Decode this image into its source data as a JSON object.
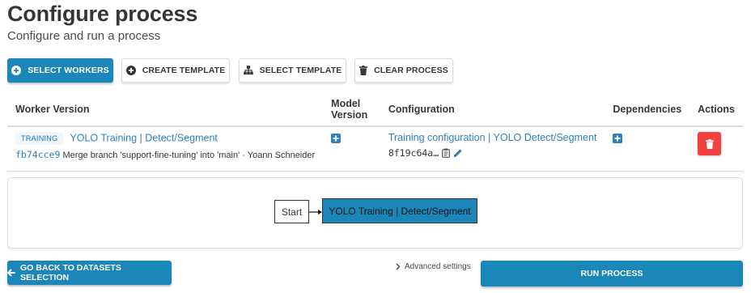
{
  "page": {
    "title": "Configure process",
    "subtitle": "Configure and run a process"
  },
  "toolbar": {
    "select_workers": "SELECT WORKERS",
    "create_template": "CREATE TEMPLATE",
    "select_template": "SELECT TEMPLATE",
    "clear_process": "CLEAR PROCESS"
  },
  "table": {
    "headers": [
      "Worker Version",
      "Model Version",
      "Configuration",
      "Dependencies",
      "Actions"
    ],
    "rows": [
      {
        "tag": "TRAINING",
        "worker_name": "YOLO Training | Detect/Segment",
        "revision_hash": "fb74cce9",
        "revision_message": "Merge branch 'support-fine-tuning' into 'main' · Yoann Schneider",
        "configuration_name": "Training configuration | YOLO Detect/Segment",
        "configuration_id": "8f19c64a…"
      }
    ]
  },
  "graph": {
    "start_label": "Start",
    "worker_label": "YOLO Training | Detect/Segment"
  },
  "footer": {
    "back_label": "GO BACK TO DATASETS SELECTION",
    "advanced_label": "Advanced settings",
    "run_label": "RUN PROCESS"
  },
  "colors": {
    "primary": "#1b86b8",
    "danger": "#f14141",
    "link": "#2f7fc1"
  }
}
